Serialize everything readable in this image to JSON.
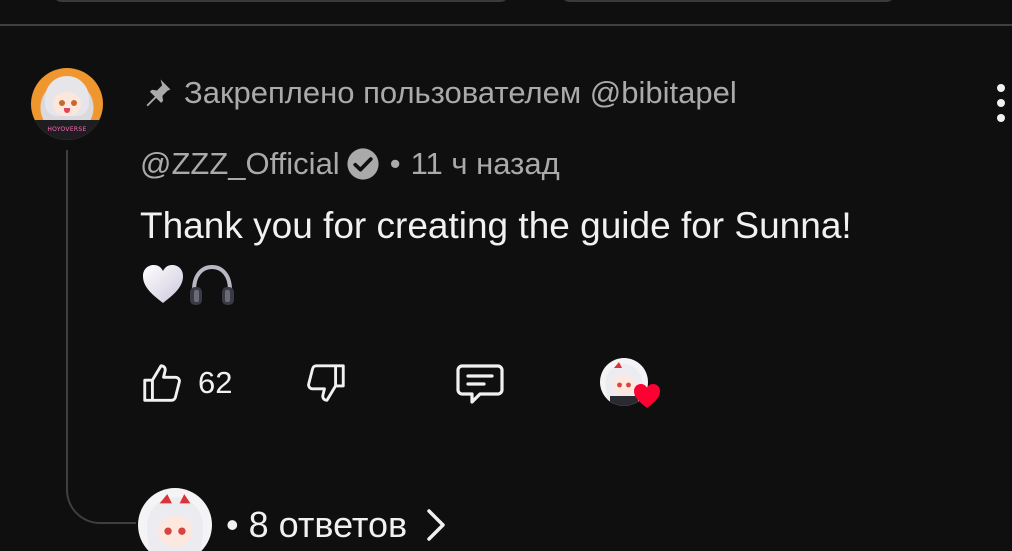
{
  "comment": {
    "pinned_label": "Закреплено пользователем @bibitapel",
    "author": "@ZZZ_Official",
    "time": "11 ч назад",
    "separator": "•",
    "text": "Thank you for creating the guide for Sunna!",
    "emojis": [
      "white-heart",
      "headphones"
    ],
    "avatar_logo_text": "HOYOVERSE"
  },
  "actions": {
    "like_count": "62",
    "like_icon": "thumbs-up-icon",
    "dislike_icon": "thumbs-down-icon",
    "reply_icon": "comment-icon",
    "creator_heart_icon": "heart-icon"
  },
  "replies": {
    "separator": "•",
    "label": "8 ответов"
  },
  "colors": {
    "background": "#0f0f0f",
    "primary_text": "#f1f1f1",
    "secondary_text": "#aaaaaa",
    "divider": "#3f3f3f",
    "heart": "#ff0033"
  }
}
